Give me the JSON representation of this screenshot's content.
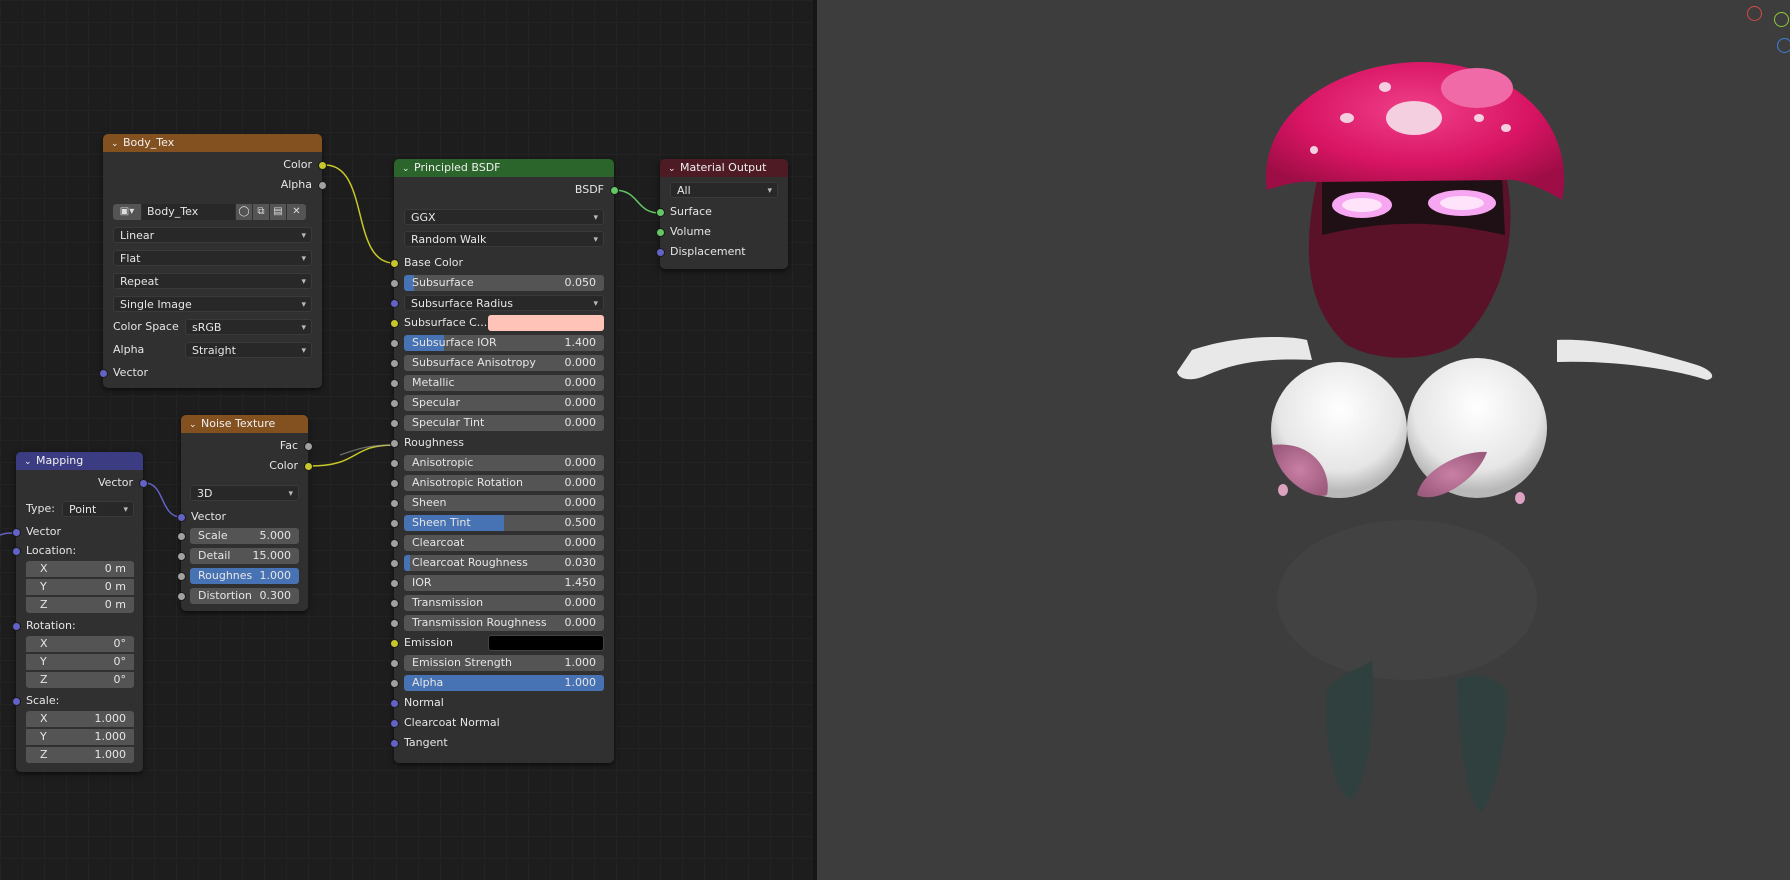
{
  "nodes": {
    "body_tex": {
      "title": "Body_Tex",
      "outputs": [
        "Color",
        "Alpha"
      ],
      "image_name": "Body_Tex",
      "interpolation": "Linear",
      "projection": "Flat",
      "extension": "Repeat",
      "source": "Single Image",
      "color_space_label": "Color Space",
      "color_space": "sRGB",
      "alpha_label": "Alpha",
      "alpha_mode": "Straight",
      "input": "Vector"
    },
    "noise": {
      "title": "Noise Texture",
      "outputs": [
        "Fac",
        "Color"
      ],
      "dimensions": "3D",
      "vector_label": "Vector",
      "fields": [
        {
          "label": "Scale",
          "value": "5.000"
        },
        {
          "label": "Detail",
          "value": "15.000"
        },
        {
          "label": "Roughnes",
          "value": "1.000",
          "fill": 1.0
        },
        {
          "label": "Distortion",
          "value": "0.300"
        }
      ]
    },
    "mapping": {
      "title": "Mapping",
      "output": "Vector",
      "type_label": "Type:",
      "type_value": "Point",
      "vector_label": "Vector",
      "location_label": "Location:",
      "location": [
        {
          "axis": "X",
          "value": "0 m"
        },
        {
          "axis": "Y",
          "value": "0 m"
        },
        {
          "axis": "Z",
          "value": "0 m"
        }
      ],
      "rotation_label": "Rotation:",
      "rotation": [
        {
          "axis": "X",
          "value": "0°"
        },
        {
          "axis": "Y",
          "value": "0°"
        },
        {
          "axis": "Z",
          "value": "0°"
        }
      ],
      "scale_label": "Scale:",
      "scale": [
        {
          "axis": "X",
          "value": "1.000"
        },
        {
          "axis": "Y",
          "value": "1.000"
        },
        {
          "axis": "Z",
          "value": "1.000"
        }
      ]
    },
    "bsdf": {
      "title": "Principled BSDF",
      "output": "BSDF",
      "distribution": "GGX",
      "subsurface_method": "Random Walk",
      "base_color_label": "Base Color",
      "subsurface_radius_label": "Subsurface Radius",
      "subsurface_color_label": "Subsurface C...",
      "subsurface_color": "#ffc3b8",
      "emission_label": "Emission",
      "emission_color": "#000000",
      "fields": [
        {
          "label": "Subsurface",
          "value": "0.050",
          "fill": 0.05
        },
        {
          "label": "Subsurface IOR",
          "value": "1.400",
          "fill": 0.2
        },
        {
          "label": "Subsurface Anisotropy",
          "value": "0.000"
        },
        {
          "label": "Metallic",
          "value": "0.000"
        },
        {
          "label": "Specular",
          "value": "0.000"
        },
        {
          "label": "Specular Tint",
          "value": "0.000"
        },
        {
          "label": "Anisotropic",
          "value": "0.000"
        },
        {
          "label": "Anisotropic Rotation",
          "value": "0.000"
        },
        {
          "label": "Sheen",
          "value": "0.000"
        },
        {
          "label": "Sheen Tint",
          "value": "0.500",
          "fill": 0.5
        },
        {
          "label": "Clearcoat",
          "value": "0.000"
        },
        {
          "label": "Clearcoat Roughness",
          "value": "0.030",
          "fill": 0.03
        },
        {
          "label": "IOR",
          "value": "1.450"
        },
        {
          "label": "Transmission",
          "value": "0.000"
        },
        {
          "label": "Transmission Roughness",
          "value": "0.000"
        },
        {
          "label": "Emission Strength",
          "value": "1.000"
        },
        {
          "label": "Alpha",
          "value": "1.000",
          "fill": 1.0
        }
      ],
      "roughness_label": "Roughness",
      "normal_label": "Normal",
      "clearcoat_normal_label": "Clearcoat Normal",
      "tangent_label": "Tangent"
    },
    "output": {
      "title": "Material Output",
      "target": "All",
      "inputs": [
        "Surface",
        "Volume",
        "Displacement"
      ]
    }
  },
  "colors": {
    "image_header": "#83501f",
    "texture_header": "#83501f",
    "vector_header": "#3c3c83",
    "shader_header": "#2b652b",
    "output_header": "#4e1b24",
    "accent": "#4772b3"
  }
}
